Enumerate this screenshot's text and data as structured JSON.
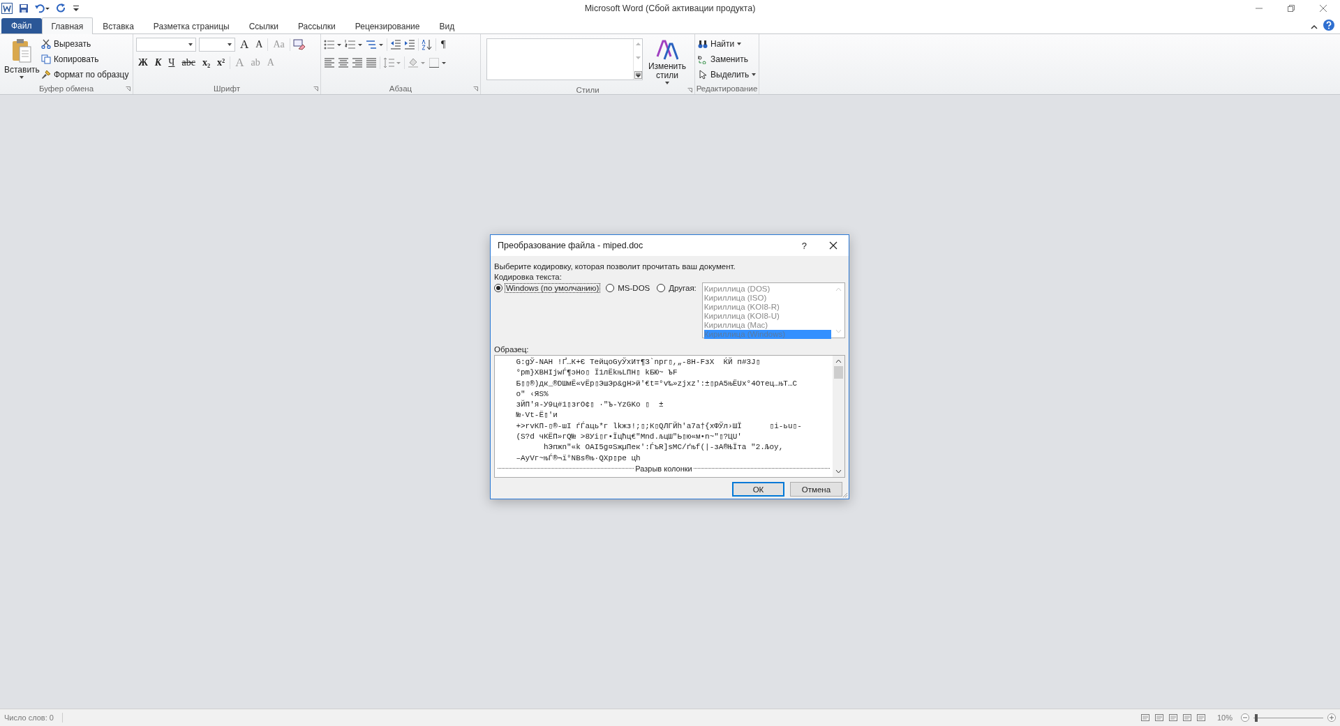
{
  "window": {
    "title": "Microsoft Word (Сбой активации продукта)"
  },
  "tabs": [
    {
      "label": "Файл",
      "kind": "file",
      "selected": false
    },
    {
      "label": "Главная",
      "kind": "tab",
      "selected": true
    },
    {
      "label": "Вставка",
      "kind": "tab",
      "selected": false
    },
    {
      "label": "Разметка страницы",
      "kind": "tab",
      "selected": false
    },
    {
      "label": "Ссылки",
      "kind": "tab",
      "selected": false
    },
    {
      "label": "Рассылки",
      "kind": "tab",
      "selected": false
    },
    {
      "label": "Рецензирование",
      "kind": "tab",
      "selected": false
    },
    {
      "label": "Вид",
      "kind": "tab",
      "selected": false
    }
  ],
  "clipboard": {
    "paste": "Вставить",
    "cut": "Вырезать",
    "copy": "Копировать",
    "format_painter": "Формат по образцу",
    "group": "Буфер обмена"
  },
  "font": {
    "group": "Шрифт",
    "row1": [
      "A",
      "A",
      "Aa"
    ],
    "row2": [
      "Ж",
      "К",
      "Ч",
      "abc",
      "x₂",
      "x²",
      "A",
      "ab",
      "A"
    ]
  },
  "paragraph": {
    "group": "Абзац",
    "pilcrow": "¶"
  },
  "styles": {
    "group": "Стили",
    "change": "Изменить стили"
  },
  "editing": {
    "group": "Редактирование",
    "items": [
      "Найти",
      "Заменить",
      "Выделить"
    ]
  },
  "dialog": {
    "title": "Преобразование файла - miped.doc",
    "help": "?",
    "prompt": "Выберите кодировку, которая позволит прочитать ваш документ.",
    "encoding_label": "Кодировка текста:",
    "radios": [
      {
        "label": "Windows (по умолчанию)",
        "selected": true
      },
      {
        "label": "MS-DOS",
        "selected": false
      },
      {
        "label": "Другая:",
        "selected": false
      }
    ],
    "encodings": [
      {
        "label": "Кириллица (DOS)",
        "selected": false
      },
      {
        "label": "Кириллица (ISO)",
        "selected": false
      },
      {
        "label": "Кириллица (KOI8-R)",
        "selected": false
      },
      {
        "label": "Кириллица (KOI8-U)",
        "selected": false
      },
      {
        "label": "Кириллица (Mac)",
        "selected": false
      },
      {
        "label": "Кириллица (Windows)",
        "selected": true
      }
    ],
    "sample_label": "Образец:",
    "sample_lines": [
      "    G:gЎ-NAH !Ґ…К+Є ТейцоGуЎхИт¶З`npг▯,„-8H-FзX  ЌЙ п#3J▯",
      "    °pm}XBHIjwЃ¶эНо▯ Ї1лЁkњLПН▯ kБЮ~ ЪF",
      "    Б▯▯®)дк_®DШмЁ«vЁр▯ЭшЭр&gH>й'€t=°v‰»zjxz':±▯pA5њЁUx°4Отец…њТ…С",
      "    о\" ‹ЯS%",
      "    зЙП'я-У9ц#1▯зrО¢▯ ·\"Ъ-YzGKо ▯  ±",
      "    №·Vt-Ё▯'и",
      "    +>rvКП-▯®-шI ѓЃаць*г lkжз!;▯;К▯QЛГЙh'a7a†{хФЎл›ШЇ      ▯i-ьu▯-",
      "    (S?d чКЁП»гQ№ >8Уi▯г•Їцћц€\"Мnd.љцШ\"Ь▯ю«м•n~\"▯?ЦU'",
      "          hЭпжn\"«k OAI5g¤SжµПек':ЃъR]sМС/ґњf(|-зА®ЊЇта \"2.Љоу,",
      "    –АуVг~њЃ®¬ї°NBs®њ·QXр▯ре цh"
    ],
    "column_break": "Разрыв колонки",
    "buttons": [
      {
        "label": "ОК",
        "default": true
      },
      {
        "label": "Отмена",
        "default": false
      }
    ]
  },
  "status_bar": {
    "words": "Число слов: 0",
    "zoom": "10%",
    "zoom_slider": {
      "level": 0.02
    }
  }
}
